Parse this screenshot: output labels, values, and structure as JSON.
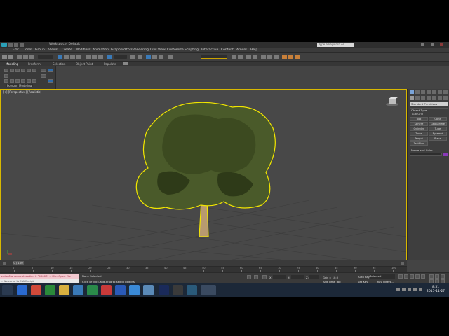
{
  "title_bar": {
    "workspace": "Workspace: Default",
    "search_placeholder": "Type a keyword or phrase"
  },
  "menu": [
    "Edit",
    "Tools",
    "Group",
    "Views",
    "Create",
    "Modifiers",
    "Animation",
    "Graph Editors",
    "Rendering",
    "Civil View",
    "Customize",
    "Scripting",
    "Interactive",
    "Content",
    "Arnold",
    "Help"
  ],
  "ribbon": {
    "tabs": [
      "Modeling",
      "Freeform",
      "Selection",
      "Object Paint",
      "Populate"
    ],
    "group_label": "Polygon Modeling"
  },
  "viewport": {
    "label": "[+] [Perspective] [Realistic]"
  },
  "command_panel": {
    "dropdown": "Standard Primitives",
    "section_object_type": "Object Type",
    "autogrid_label": "AutoGrid",
    "object_buttons": [
      "Box",
      "Cone",
      "Sphere",
      "GeoSphere",
      "Cylinder",
      "Tube",
      "Torus",
      "Pyramid",
      "Teapot",
      "Plane",
      "TextPlus"
    ],
    "section_name_color": "Name and Color"
  },
  "timeline": {
    "frame_indicator": "0 / 100",
    "ticks": [
      "0",
      "5",
      "10",
      "15",
      "20",
      "25",
      "30",
      "35",
      "40",
      "45",
      "50",
      "55",
      "60",
      "65",
      "70",
      "75",
      "80",
      "85",
      "90",
      "95",
      "100"
    ]
  },
  "status": {
    "maxscript_line1": "actionMan.executeAction 0 \"40003\"  -- File: Open File",
    "maxscript_line2": "-- Welcome to MAXScript.",
    "selection": "None Selected",
    "prompt": "Click or click-and-drag to select objects",
    "coord_x": "X:",
    "coord_y": "Y:",
    "coord_z": "Z:",
    "grid": "Grid = 10.0",
    "add_time_tag": "Add Time Tag",
    "auto_key": "Auto Key",
    "set_key": "Set Key",
    "key_filters": "Key Filters...",
    "selected": "Selected"
  },
  "taskbar": {
    "time": "8:51",
    "date": "2015-11-27"
  },
  "colors": {
    "selection_yellow": "#d8b800",
    "viewport_bg": "#484848",
    "taskbar_bg": "#1c2838"
  }
}
